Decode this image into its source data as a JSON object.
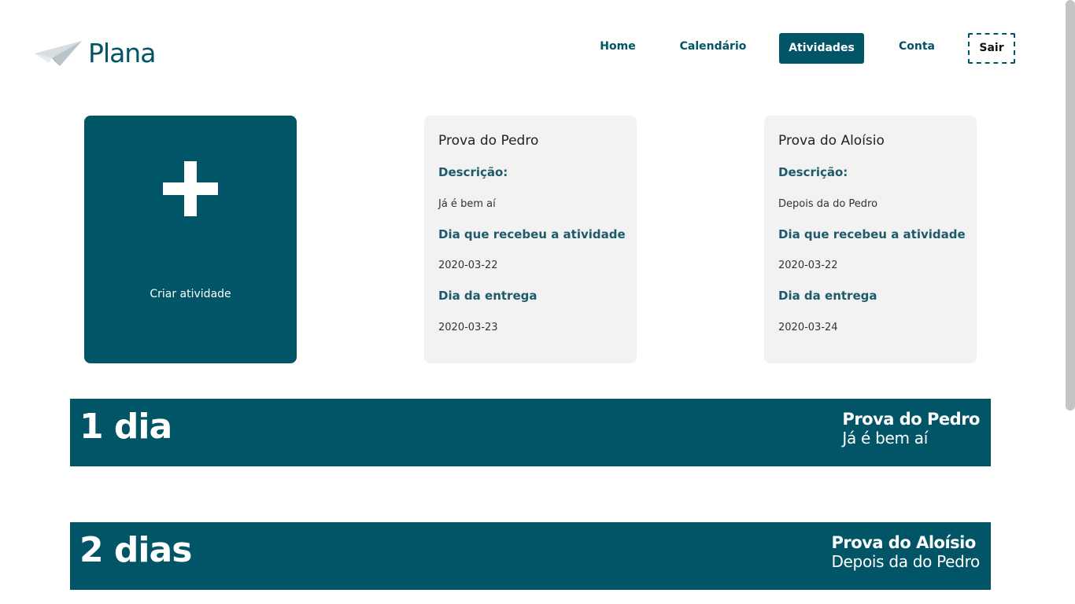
{
  "header": {
    "brand": "Plana",
    "nav": {
      "home": "Home",
      "calendar": "Calendário",
      "activities": "Atividades",
      "account": "Conta",
      "logout": "Sair"
    }
  },
  "create_card": {
    "label": "Criar atividade"
  },
  "activities": [
    {
      "title": "Prova do Pedro",
      "desc_label": "Descrição:",
      "desc": "Já é bem aí",
      "received_label": "Dia que recebeu a atividade",
      "received": "2020-03-22",
      "due_label": "Dia da entrega",
      "due": "2020-03-23"
    },
    {
      "title": "Prova do Aloísio",
      "desc_label": "Descrição:",
      "desc": "Depois da do Pedro",
      "received_label": "Dia que recebeu a atividade",
      "received": "2020-03-22",
      "due_label": "Dia da entrega",
      "due": "2020-03-24"
    }
  ],
  "countdown": [
    {
      "days": "1 dia",
      "title": "Prova do Pedro",
      "desc": "Já é bem aí"
    },
    {
      "days": "2 dias",
      "title": "Prova do Aloísio",
      "desc": "Depois da do Pedro"
    }
  ],
  "colors": {
    "primary": "#015566",
    "card_bg": "#f2f2f2"
  }
}
